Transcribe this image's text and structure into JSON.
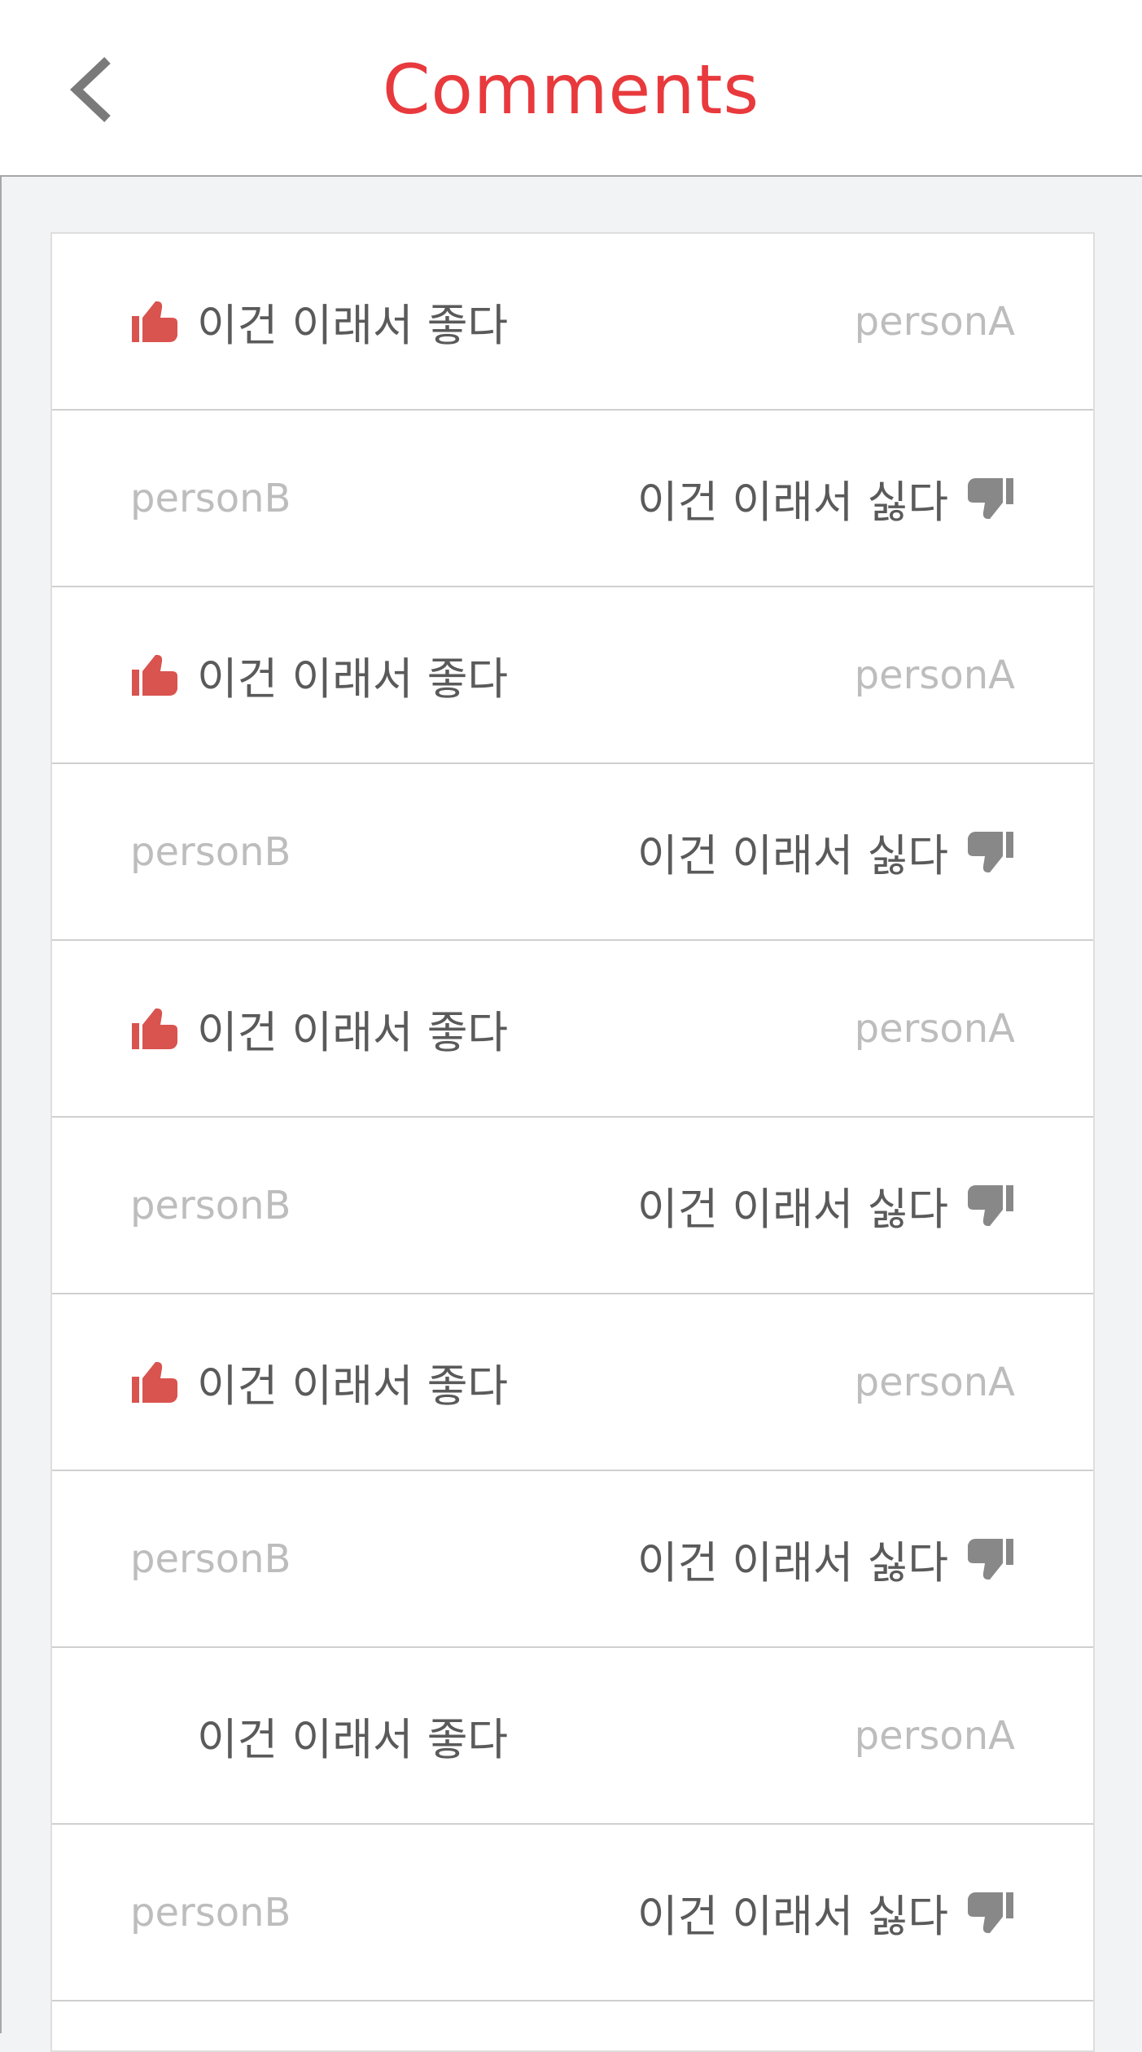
{
  "header": {
    "title": "Comments",
    "title_color": "#e8393d",
    "back_icon": "chevron-left-icon"
  },
  "comments": [
    {
      "type": "like",
      "text": "이건 이래서 좋다",
      "author": "personA",
      "icon": "thumbs-up-icon",
      "icon_visible": true
    },
    {
      "type": "dislike",
      "text": "이건 이래서 싫다",
      "author": "personB",
      "icon": "thumbs-down-icon",
      "icon_visible": true
    },
    {
      "type": "like",
      "text": "이건 이래서 좋다",
      "author": "personA",
      "icon": "thumbs-up-icon",
      "icon_visible": true
    },
    {
      "type": "dislike",
      "text": "이건 이래서 싫다",
      "author": "personB",
      "icon": "thumbs-down-icon",
      "icon_visible": true
    },
    {
      "type": "like",
      "text": "이건 이래서 좋다",
      "author": "personA",
      "icon": "thumbs-up-icon",
      "icon_visible": true
    },
    {
      "type": "dislike",
      "text": "이건 이래서 싫다",
      "author": "personB",
      "icon": "thumbs-down-icon",
      "icon_visible": true
    },
    {
      "type": "like",
      "text": "이건 이래서 좋다",
      "author": "personA",
      "icon": "thumbs-up-icon",
      "icon_visible": true
    },
    {
      "type": "dislike",
      "text": "이건 이래서 싫다",
      "author": "personB",
      "icon": "thumbs-down-icon",
      "icon_visible": true
    },
    {
      "type": "like",
      "text": "이건 이래서 좋다",
      "author": "personA",
      "icon": "thumbs-up-icon",
      "icon_visible": false
    },
    {
      "type": "dislike",
      "text": "이건 이래서 싫다",
      "author": "personB",
      "icon": "thumbs-down-icon",
      "icon_visible": true
    }
  ],
  "colors": {
    "like_icon": "#d9534f",
    "dislike_icon": "#888888",
    "comment_text": "#5a5a5a",
    "author_text": "#bdbdbd",
    "background": "#f2f3f5"
  }
}
